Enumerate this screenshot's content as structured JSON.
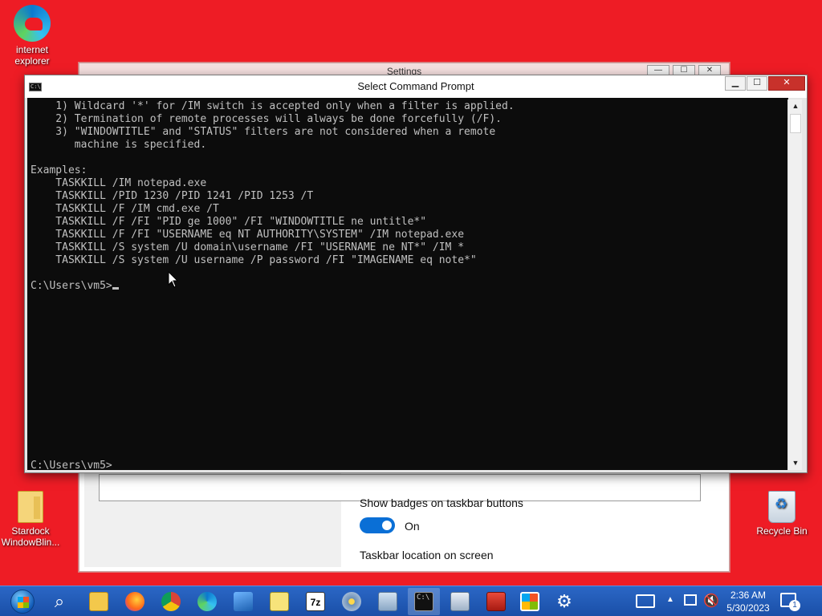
{
  "desktop": {
    "icons": [
      {
        "label": "internet explorer"
      },
      {
        "label": "Stardock WindowBlin..."
      },
      {
        "label": "Recycle Bin"
      }
    ]
  },
  "settings_window": {
    "title": "Settings",
    "show_badges_label": "Show badges on taskbar buttons",
    "toggle_state": "On",
    "taskbar_location_label": "Taskbar location on screen"
  },
  "cmd_window": {
    "title": "Select Command Prompt",
    "lines": [
      "    1) Wildcard '*' for /IM switch is accepted only when a filter is applied.",
      "    2) Termination of remote processes will always be done forcefully (/F).",
      "    3) \"WINDOWTITLE\" and \"STATUS\" filters are not considered when a remote",
      "       machine is specified.",
      "",
      "Examples:",
      "    TASKKILL /IM notepad.exe",
      "    TASKKILL /PID 1230 /PID 1241 /PID 1253 /T",
      "    TASKKILL /F /IM cmd.exe /T",
      "    TASKKILL /F /FI \"PID ge 1000\" /FI \"WINDOWTITLE ne untitle*\"",
      "    TASKKILL /F /FI \"USERNAME eq NT AUTHORITY\\SYSTEM\" /IM notepad.exe",
      "    TASKKILL /S system /U domain\\username /FI \"USERNAME ne NT*\" /IM *",
      "    TASKKILL /S system /U username /P password /FI \"IMAGENAME eq note*\"",
      "",
      "C:\\Users\\vm5>"
    ],
    "bottom_prompt": "C:\\Users\\vm5>",
    "icon_text": "C:\\"
  },
  "taskbar": {
    "clock_time": "2:36 AM",
    "clock_date": "5/30/2023",
    "notification_count": "1",
    "tray_expand": "▲",
    "apps": [
      {
        "name": "search",
        "glyph": "⌕"
      },
      {
        "name": "file-explorer"
      },
      {
        "name": "firefox"
      },
      {
        "name": "chrome"
      },
      {
        "name": "edge"
      },
      {
        "name": "photos"
      },
      {
        "name": "notepad"
      },
      {
        "name": "7zip",
        "glyph": "7z"
      },
      {
        "name": "media"
      },
      {
        "name": "monitor"
      },
      {
        "name": "command-prompt",
        "glyph": "C:\\"
      },
      {
        "name": "remote-desktop"
      },
      {
        "name": "toolbox"
      },
      {
        "name": "store"
      },
      {
        "name": "settings",
        "glyph": "⚙"
      }
    ]
  },
  "colors": {
    "desktop_bg": "#ee1c25",
    "cmd_bg": "#0c0c0c",
    "cmd_fg": "#c0c0c0",
    "taskbar": "#2b67c6",
    "toggle_on": "#0a6fd6"
  }
}
